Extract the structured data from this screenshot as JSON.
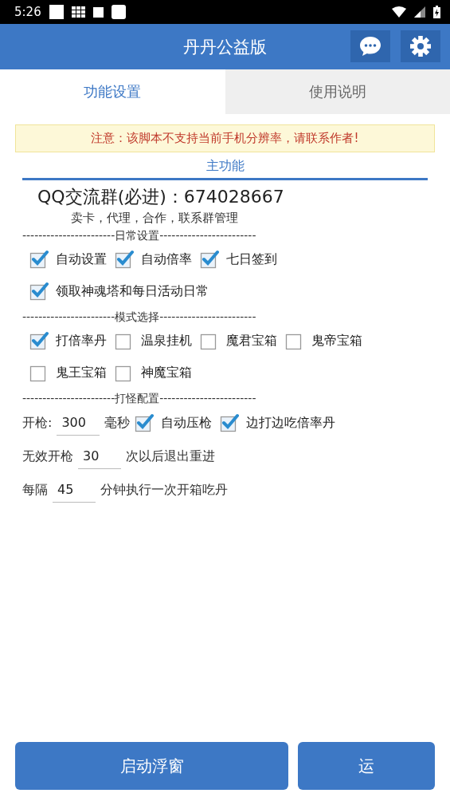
{
  "status_bar": {
    "time": "5:26"
  },
  "header": {
    "title": "丹丹公益版"
  },
  "tabs": [
    {
      "label": "功能设置",
      "selected": true
    },
    {
      "label": "使用说明",
      "selected": false
    }
  ],
  "notice": "注意：该脚本不支持当前手机分辨率，请联系作者!",
  "section_title": "主功能",
  "qq_group": "QQ交流群(必进)：674028667",
  "qq_note": "卖卡，代理，合作，联系群管理",
  "groups": [
    {
      "divider": "-----------------------日常设置------------------------",
      "rows": [
        [
          {
            "kind": "checkbox",
            "label": "自动设置",
            "checked": true
          },
          {
            "kind": "checkbox",
            "label": "自动倍率",
            "checked": true
          },
          {
            "kind": "checkbox",
            "label": "七日签到",
            "checked": true
          }
        ],
        [
          {
            "kind": "checkbox",
            "label": "领取神魂塔和每日活动日常",
            "checked": true
          }
        ]
      ]
    },
    {
      "divider": "-----------------------模式选择------------------------",
      "rows": [
        [
          {
            "kind": "checkbox",
            "label": "打倍率丹",
            "checked": true
          },
          {
            "kind": "checkbox",
            "label": "温泉挂机",
            "checked": false
          },
          {
            "kind": "checkbox",
            "label": "魔君宝箱",
            "checked": false
          },
          {
            "kind": "checkbox",
            "label": "鬼帝宝箱",
            "checked": false
          }
        ],
        [
          {
            "kind": "checkbox",
            "label": "鬼王宝箱",
            "checked": false
          },
          {
            "kind": "checkbox",
            "label": "神魔宝箱",
            "checked": false
          }
        ]
      ]
    },
    {
      "divider": "-----------------------打怪配置------------------------",
      "rows": [
        [
          {
            "kind": "text",
            "text": "开枪:"
          },
          {
            "kind": "input",
            "value": "300"
          },
          {
            "kind": "text",
            "text": "毫秒"
          },
          {
            "kind": "checkbox",
            "label": "自动压枪",
            "checked": true
          },
          {
            "kind": "checkbox",
            "label": "边打边吃倍率丹",
            "checked": true
          }
        ],
        [
          {
            "kind": "text",
            "text": "无效开枪"
          },
          {
            "kind": "input",
            "value": "30"
          },
          {
            "kind": "text",
            "text": "次以后退出重进"
          }
        ],
        [
          {
            "kind": "text",
            "text": "每隔"
          },
          {
            "kind": "input",
            "value": "45"
          },
          {
            "kind": "text",
            "text": "分钟执行一次开箱吃丹"
          }
        ]
      ]
    }
  ],
  "buttons": [
    {
      "label": "启动浮窗"
    },
    {
      "label": "运"
    }
  ]
}
